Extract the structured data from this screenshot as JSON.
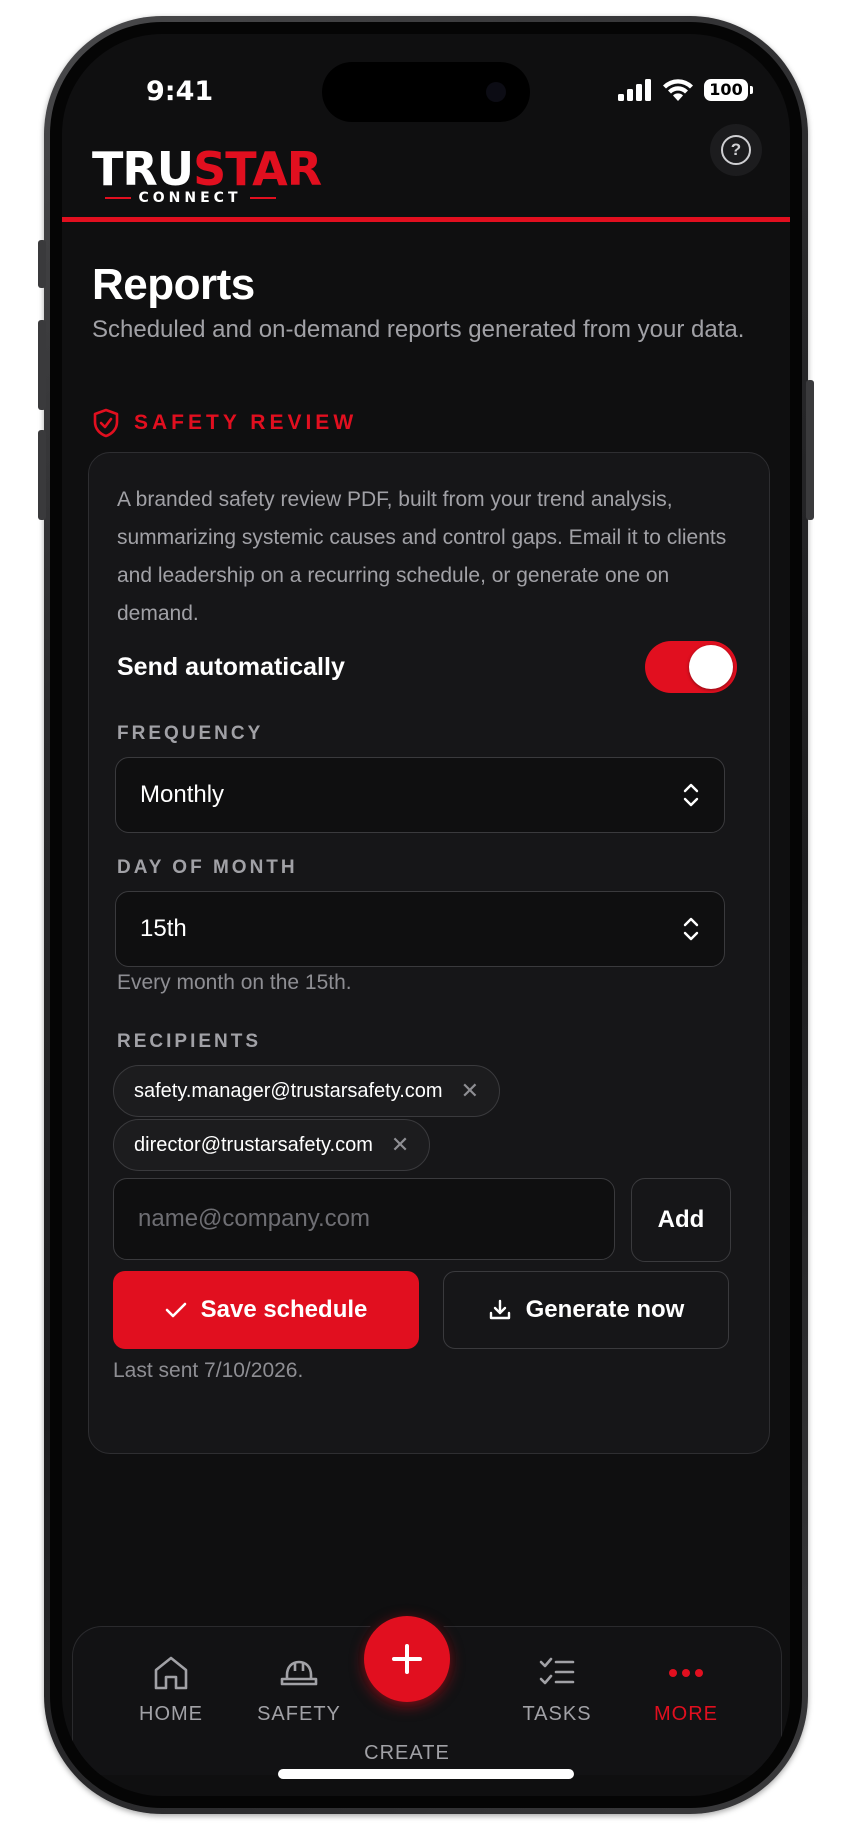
{
  "status_bar": {
    "time": "9:41",
    "battery": "100"
  },
  "header": {
    "logo_main_a": "TRU",
    "logo_main_b": "STAR",
    "logo_sub": "CONNECT"
  },
  "page": {
    "title": "Reports",
    "subtitle": "Scheduled and on-demand reports generated from your data."
  },
  "section": {
    "title": "SAFETY REVIEW"
  },
  "card": {
    "description": "A branded safety review PDF, built from your trend analysis, summarizing systemic causes and control gaps. Email it to clients and leadership on a recurring schedule, or generate one on demand.",
    "auto_send": {
      "label": "Send automatically",
      "enabled": true
    },
    "frequency": {
      "label": "FREQUENCY",
      "value": "Monthly"
    },
    "day_of_month": {
      "label": "DAY OF MONTH",
      "value": "15th",
      "helper": "Every month on the 15th."
    },
    "recipients": {
      "label": "RECIPIENTS",
      "items": [
        "safety.manager@trustarsafety.com",
        "director@trustarsafety.com"
      ],
      "input_placeholder": "name@company.com",
      "add_label": "Add"
    },
    "save_label": "Save schedule",
    "generate_label": "Generate now",
    "last_sent": "Last sent 7/10/2026."
  },
  "tabs": {
    "home": "HOME",
    "safety": "SAFETY",
    "create": "CREATE",
    "tasks": "TASKS",
    "more": "MORE",
    "active": "more"
  },
  "colors": {
    "accent": "#e10f1f",
    "background": "#0f0f10",
    "card": "#161618",
    "muted": "#a1a1a6"
  }
}
